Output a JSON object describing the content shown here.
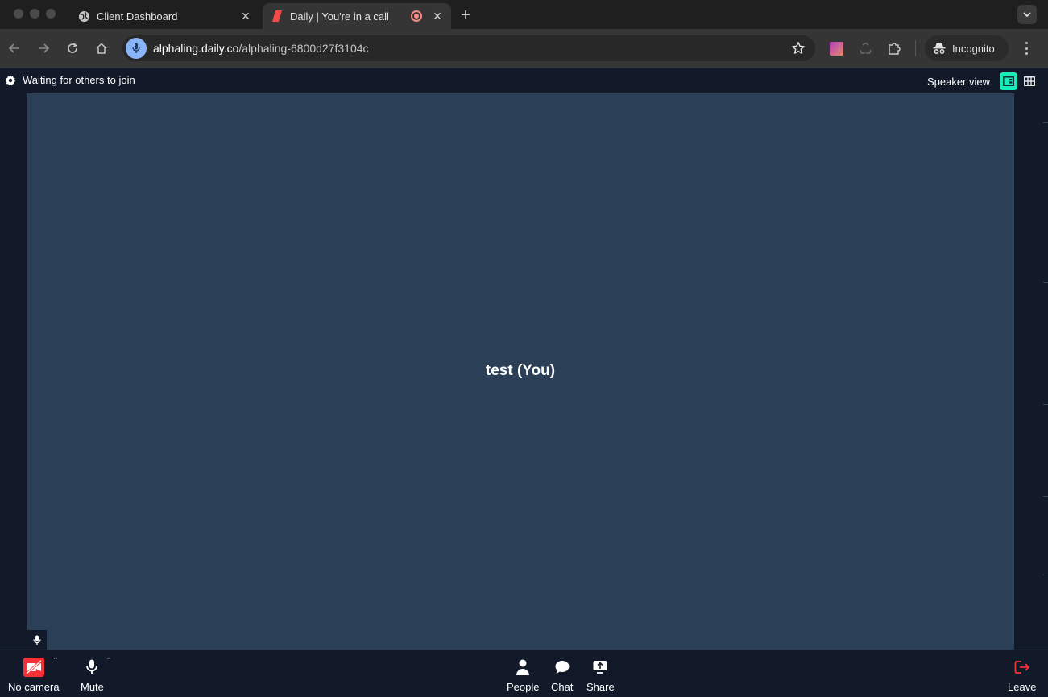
{
  "browser": {
    "tabs": [
      {
        "title": "Client Dashboard",
        "active": false
      },
      {
        "title": "Daily | You're in a call",
        "active": true
      }
    ],
    "url_host": "alphaling.daily.co",
    "url_path": "/alphaling-6800d27f3104c",
    "incognito_label": "Incognito"
  },
  "app": {
    "status_text": "Waiting for others to join",
    "view_label": "Speaker view",
    "participant_name": "test (You)",
    "accent_color": "#1bebb9",
    "tile_color": "#2b3f56"
  },
  "tray": {
    "camera_label": "No camera",
    "mute_label": "Mute",
    "people_label": "People",
    "chat_label": "Chat",
    "share_label": "Share",
    "leave_label": "Leave",
    "leave_color": "#f63135"
  }
}
